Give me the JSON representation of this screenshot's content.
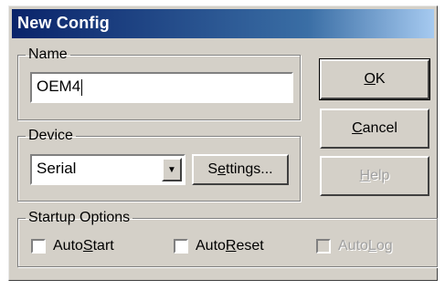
{
  "window": {
    "title": "New Config"
  },
  "name_group": {
    "legend": "Name",
    "value": "OEM4"
  },
  "device_group": {
    "legend": "Device",
    "selected": "Serial",
    "settings": {
      "pre": "S",
      "mnemonic": "e",
      "post": "ttings..."
    }
  },
  "buttons": {
    "ok": {
      "mnemonic": "O",
      "post": "K"
    },
    "cancel": {
      "pre": "",
      "mnemonic": "C",
      "post": "ancel"
    },
    "help": {
      "pre": "",
      "mnemonic": "H",
      "post": "elp"
    }
  },
  "startup_group": {
    "legend": "Startup Options",
    "autostart": {
      "pre": "Auto",
      "mnemonic": "S",
      "post": "tart",
      "checked": false
    },
    "autoreset": {
      "pre": "Auto",
      "mnemonic": "R",
      "post": "eset",
      "checked": false
    },
    "autolog": {
      "pre": "Auto",
      "mnemonic": "L",
      "post": "og",
      "checked": false,
      "disabled": true
    }
  },
  "colors": {
    "titlebar_start": "#0a246a",
    "titlebar_end": "#a6caf0",
    "face": "#d4d0c8"
  }
}
